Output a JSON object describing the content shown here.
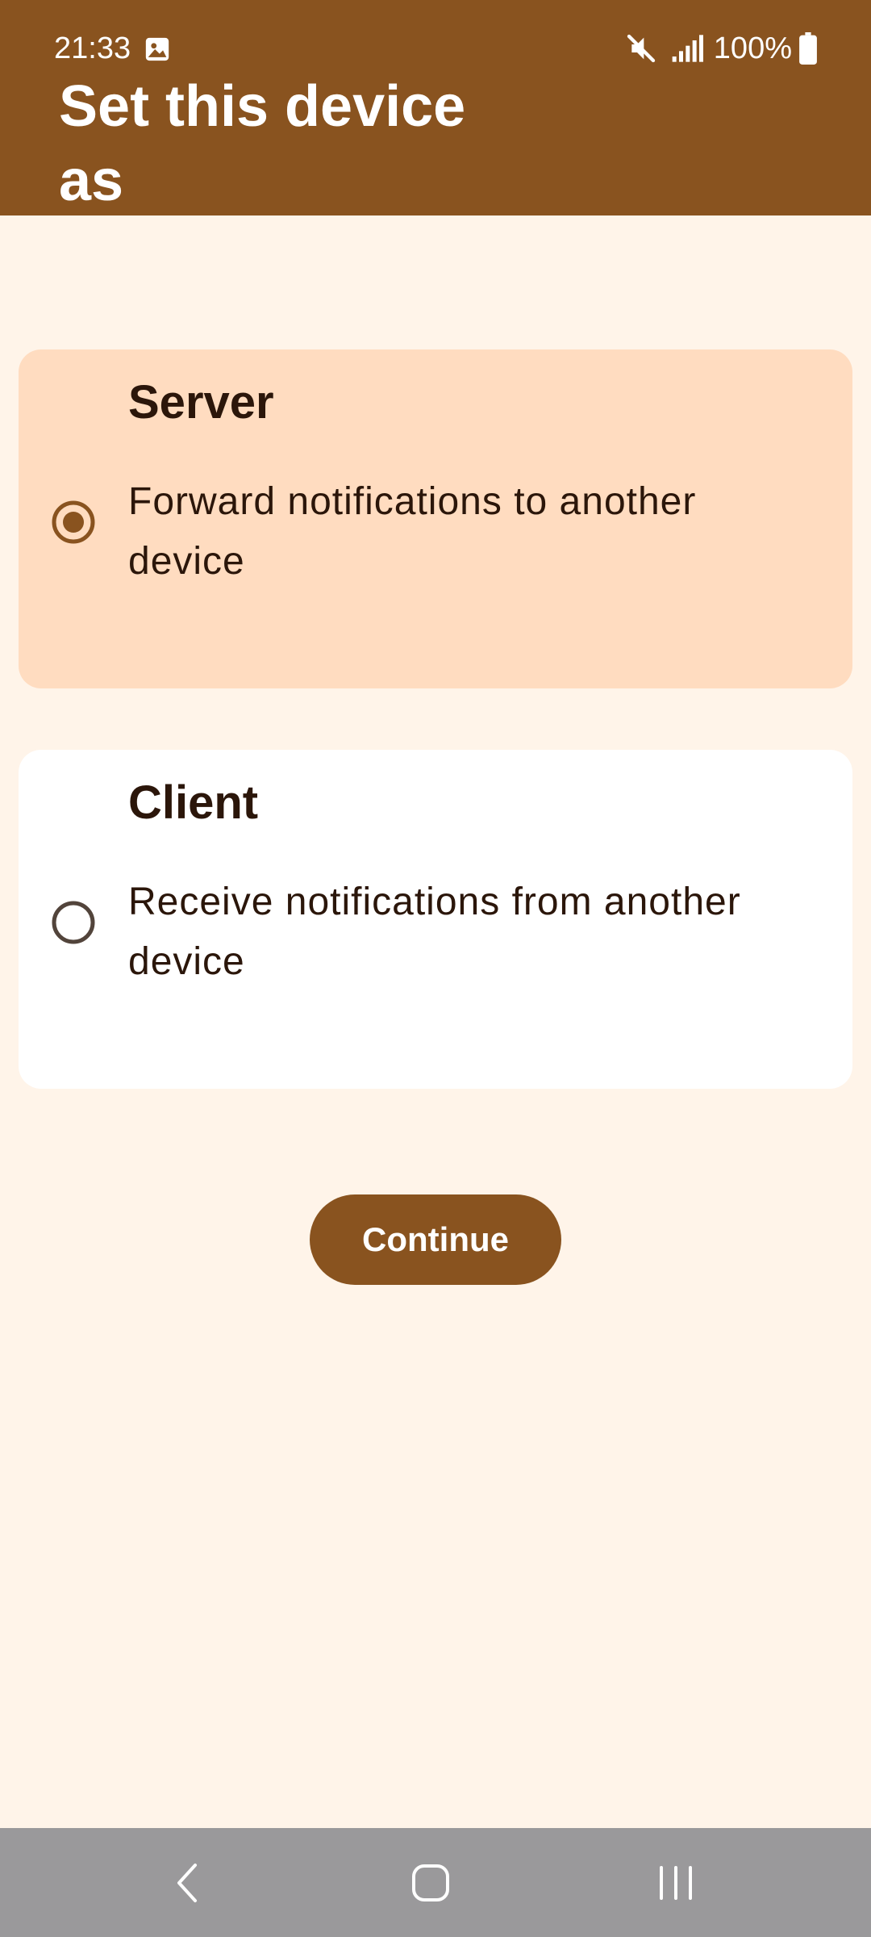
{
  "status_bar": {
    "time": "21:33",
    "battery": "100%",
    "icons": [
      "image-icon",
      "mute-icon",
      "signal-icon",
      "battery-icon"
    ]
  },
  "header": {
    "title": "Set this device as"
  },
  "options": [
    {
      "title": "Server",
      "description": "Forward notifications to another device",
      "selected": true
    },
    {
      "title": "Client",
      "description": "Receive notifications from another device",
      "selected": false
    }
  ],
  "continue_label": "Continue",
  "nav_bar": {
    "icons": [
      "back-icon",
      "home-icon",
      "recents-icon"
    ]
  },
  "colors": {
    "primary": "#89531F",
    "background": "#FFF4E9",
    "selected_card": "#FFDCC0",
    "unselected_card": "#FFFFFF",
    "text": "#2B160A",
    "nav_bar": "#9A999B"
  }
}
